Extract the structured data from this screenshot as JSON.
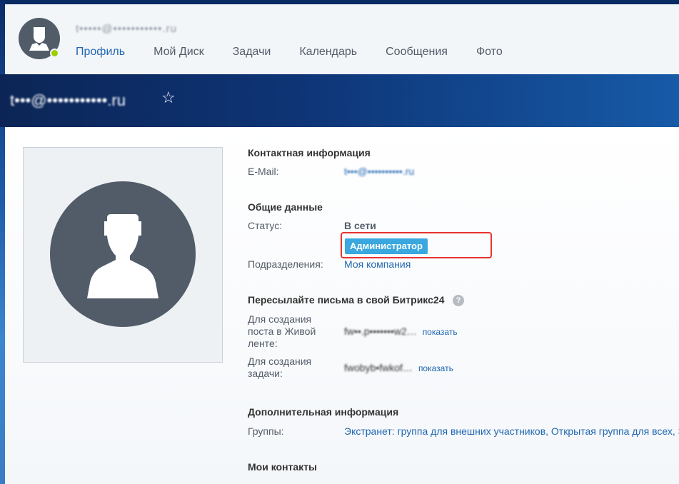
{
  "header": {
    "user_name": "t•••••@•••••••••••.ru",
    "nav": [
      {
        "label": "Профиль",
        "active": true
      },
      {
        "label": "Мой Диск",
        "active": false
      },
      {
        "label": "Задачи",
        "active": false
      },
      {
        "label": "Календарь",
        "active": false
      },
      {
        "label": "Сообщения",
        "active": false
      },
      {
        "label": "Фото",
        "active": false
      }
    ]
  },
  "page": {
    "title": "t•••@•••••••••••.ru",
    "star": "☆"
  },
  "contact": {
    "title": "Контактная информация",
    "email_label": "E-Mail:",
    "email_value": "t•••@••••••••••.ru"
  },
  "general": {
    "title": "Общие данные",
    "status_label": "Статус:",
    "status_value": "В сети",
    "admin_badge": "Администратор",
    "departments_label": "Подразделения:",
    "departments_value": "Моя компания"
  },
  "forward": {
    "title": "Пересылайте письма в свой Битрикс24",
    "help": "?",
    "post_label": "Для создания поста в Живой ленте:",
    "post_value": "fw••.p•••••••w2…",
    "post_show": "показать",
    "task_label": "Для создания задачи:",
    "task_value": "fwobyb•fwkof…",
    "task_show": "показать"
  },
  "additional": {
    "title": "Дополнительная информация",
    "groups_label": "Группы:",
    "groups_value": "Экстранет: группа для внешних участников, Открытая группа для всех, З"
  },
  "contacts": {
    "title": "Мои контакты"
  },
  "colors": {
    "accent": "#2067b0",
    "online": "#9dcf00",
    "badge": "#3aa8de",
    "highlight": "#e8342f"
  }
}
